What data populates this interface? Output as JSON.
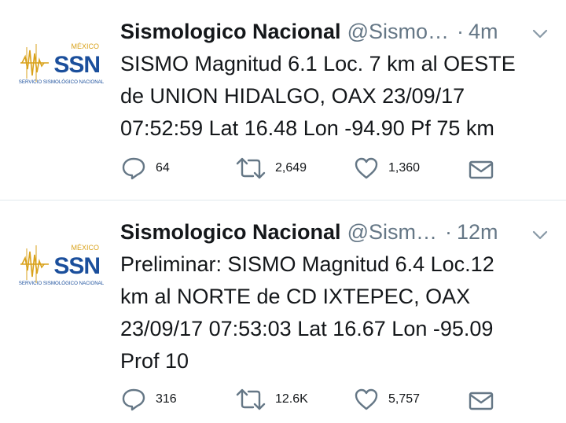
{
  "tweets": [
    {
      "author_name": "Sismologico Nacional",
      "handle": "@Sismo…",
      "separator": "·",
      "time": "4m",
      "text_lines": [
        "SISMO Magnitud 6.1 Loc. 7 km al OESTE",
        "de UNION HIDALGO, OAX 23/09/17",
        "07:52:59 Lat 16.48 Lon -94.90 Pf 75 km"
      ],
      "replies": "64",
      "retweets": "2,649",
      "likes": "1,360"
    },
    {
      "author_name": "Sismologico Nacional",
      "handle": "@Sism…",
      "separator": "·",
      "time": "12m",
      "text_lines": [
        "Preliminar: SISMO Magnitud 6.4 Loc.12",
        "km al NORTE de CD IXTEPEC, OAX",
        "23/09/17 07:53:03 Lat 16.67 Lon -95.09",
        "Prof 10"
      ],
      "replies": "316",
      "retweets": "12.6K",
      "likes": "5,757"
    }
  ],
  "logo": {
    "country": "MÉXICO",
    "acronym": "SSN",
    "subtitle": "SERVICIO SISMOLÓGICO NACIONAL"
  },
  "icons": {
    "reply": "reply-icon",
    "retweet": "retweet-icon",
    "like": "heart-icon",
    "dm": "envelope-icon",
    "caret": "chevron-down-icon"
  },
  "colors": {
    "text": "#14171a",
    "secondary": "#657786",
    "divider": "#e1e8ed",
    "logo_blue": "#1b4f9c",
    "logo_gold": "#d9a21b"
  }
}
